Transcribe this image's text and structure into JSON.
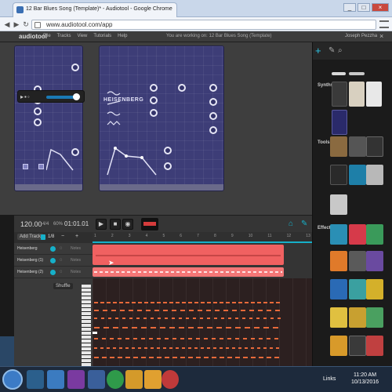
{
  "browser": {
    "tab_title": "12 Bar Blues Song (Template)* - Audiotool - Google Chrome",
    "url": "www.audiotool.com/app",
    "window_controls": [
      "_",
      "□",
      "×"
    ]
  },
  "app": {
    "logo": "audiotool",
    "menu": [
      "File",
      "Tracks",
      "View",
      "Tutorials",
      "Help"
    ],
    "notice": "You are working on: 12 Bar Blues Song (Template)",
    "user": "Joseph Pezzha"
  },
  "desk": {
    "device_title": "HEISENBERG"
  },
  "right_panel": {
    "sections": [
      "Synths",
      "Tools",
      "Effects"
    ]
  },
  "sequencer": {
    "tempo": "120.00",
    "signature": "4/4",
    "zoom": "60%",
    "timecode": "01:01.01",
    "add_track": "Add Track",
    "snap": "1/8",
    "ruler": [
      "1",
      "2",
      "3",
      "4",
      "5",
      "6",
      "7",
      "8",
      "9",
      "10",
      "11",
      "12",
      "13"
    ],
    "tracks": [
      {
        "name": "Heisenberg",
        "label": "Notes"
      },
      {
        "name": "Heisenberg (1)",
        "label": "Notes"
      },
      {
        "name": "Heisenberg (2)",
        "label": "Notes"
      }
    ],
    "shuffle": "Shuffle"
  },
  "taskbar": {
    "links": "Links",
    "time": "11:20 AM",
    "date": "10/13/2016"
  },
  "colors": {
    "accent": "#16b0c9",
    "clip": "#f06161",
    "device": "#3d3d77"
  }
}
